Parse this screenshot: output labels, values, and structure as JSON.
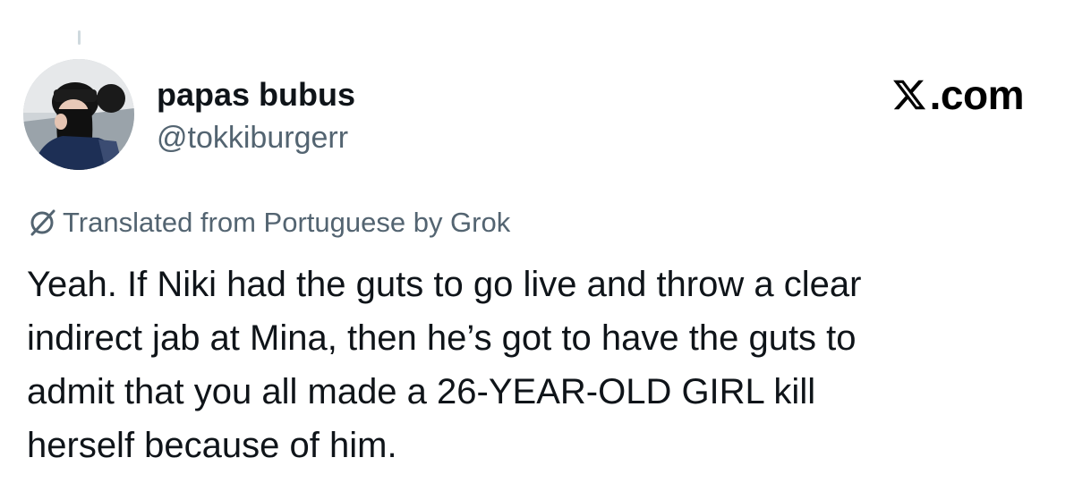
{
  "author": {
    "display_name": "papas bubus",
    "handle": "@tokkiburgerr",
    "avatar_icon": "profile-photo"
  },
  "brand": {
    "text": ".com",
    "icon": "x-logo-icon"
  },
  "translation": {
    "icon": "translate-icon",
    "text": "Translated from Portuguese by Grok"
  },
  "tweet": {
    "lines": [
      "Yeah. If Niki had the guts to go live and throw a clear",
      "indirect jab at Mina, then he’s got to have the guts to",
      "admit that you all made a 26-YEAR-OLD GIRL kill",
      "herself because of him."
    ]
  },
  "colors": {
    "primary_text": "#0f1419",
    "secondary_text": "#536471",
    "background": "#ffffff"
  }
}
